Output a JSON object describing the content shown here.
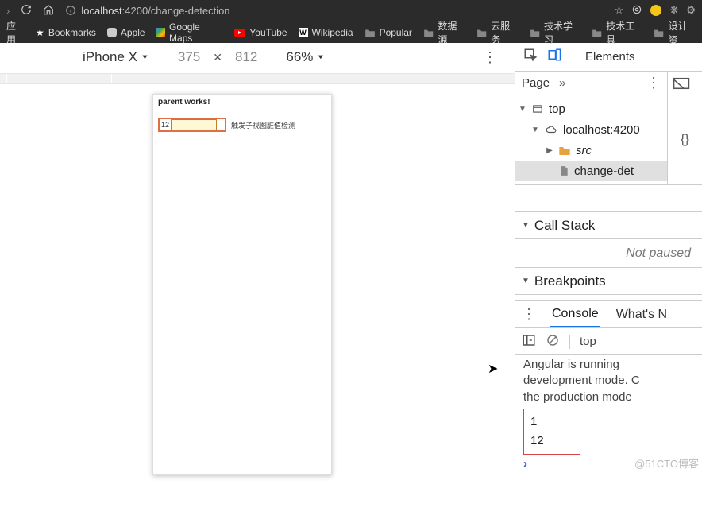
{
  "browser": {
    "nav": {
      "reload": "reload-icon",
      "home": "home-icon",
      "info": "info-icon"
    },
    "url_host": "localhost",
    "url_port_path": ":4200/change-detection",
    "right": {
      "star": "star-icon",
      "target": "target-icon",
      "circle": "circle-yellow-icon",
      "ext1": "extension-icon",
      "ext2": "extension2-icon"
    }
  },
  "bookmarks": {
    "items": [
      {
        "label": "应用",
        "icon": "apps"
      },
      {
        "label": "Bookmarks",
        "icon": "star"
      },
      {
        "label": "Apple",
        "icon": "apple"
      },
      {
        "label": "Google Maps",
        "icon": "gmaps"
      },
      {
        "label": "YouTube",
        "icon": "youtube"
      },
      {
        "label": "Wikipedia",
        "icon": "wiki"
      },
      {
        "label": "Popular",
        "icon": "folder"
      },
      {
        "label": "数据源",
        "icon": "folder"
      },
      {
        "label": "云服务",
        "icon": "folder"
      },
      {
        "label": "技术学习",
        "icon": "folder"
      },
      {
        "label": "技术工具",
        "icon": "folder"
      },
      {
        "label": "设计资",
        "icon": "folder"
      }
    ]
  },
  "device": {
    "name": "iPhone X",
    "width": "375",
    "height": "812",
    "zoom": "66%"
  },
  "app": {
    "heading": "parent works!",
    "input_value": "12",
    "button_label": "触发子视图脏值检测"
  },
  "devtools": {
    "elements_tab": "Elements",
    "sources": {
      "page_tab": "Page",
      "tree": {
        "top": "top",
        "host": "localhost:4200",
        "src": "src",
        "file": "change-det"
      },
      "callstack_title": "Call Stack",
      "callstack_status": "Not paused",
      "breakpoints_title": "Breakpoints"
    },
    "console": {
      "tabs": {
        "console": "Console",
        "whatsnew": "What's N"
      },
      "context": "top",
      "lines": {
        "l1": "Angular is running",
        "l2": "development mode. C",
        "l3": "the production mode",
        "box1": "1",
        "box2": "12"
      }
    }
  },
  "watermark": "@51CTO博客"
}
